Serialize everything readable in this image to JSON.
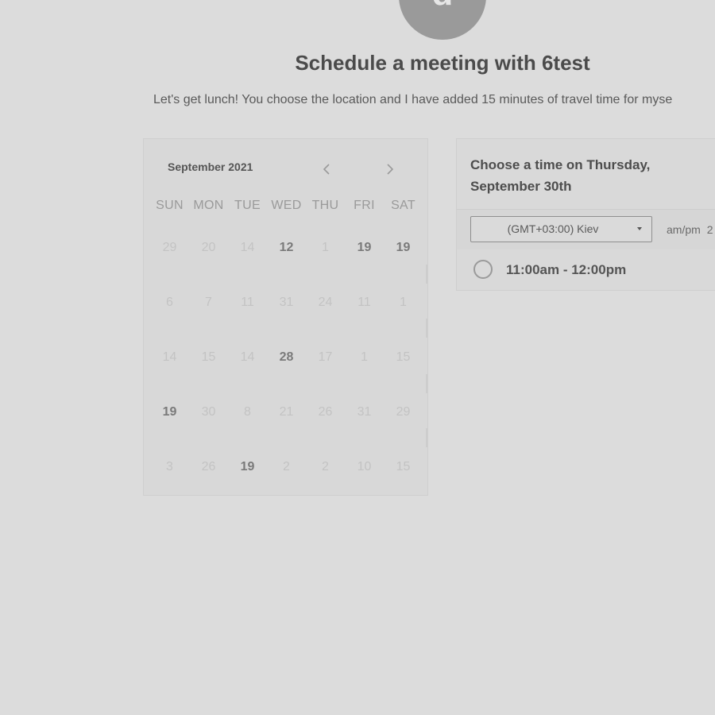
{
  "avatar": {
    "initial": "d"
  },
  "header": {
    "title": "Schedule a meeting with 6test",
    "subtitle": "Let's get lunch! You choose the location and I have added 15 minutes of travel time for myse"
  },
  "calendar": {
    "month_label": "September 2021",
    "weekdays": [
      "SUN",
      "MON",
      "TUE",
      "WED",
      "THU",
      "FRI",
      "SAT"
    ],
    "weeks": [
      [
        {
          "label": "29",
          "available": false
        },
        {
          "label": "20",
          "available": false
        },
        {
          "label": "14",
          "available": false
        },
        {
          "label": "12",
          "available": true
        },
        {
          "label": "1",
          "available": false
        },
        {
          "label": "19",
          "available": true
        },
        {
          "label": "19",
          "available": true
        }
      ],
      [
        {
          "label": "6",
          "available": false
        },
        {
          "label": "7",
          "available": false
        },
        {
          "label": "11",
          "available": false
        },
        {
          "label": "31",
          "available": false
        },
        {
          "label": "24",
          "available": false
        },
        {
          "label": "11",
          "available": false
        },
        {
          "label": "1",
          "available": false
        }
      ],
      [
        {
          "label": "14",
          "available": false
        },
        {
          "label": "15",
          "available": false
        },
        {
          "label": "14",
          "available": false
        },
        {
          "label": "28",
          "available": true
        },
        {
          "label": "17",
          "available": false
        },
        {
          "label": "1",
          "available": false
        },
        {
          "label": "15",
          "available": false
        }
      ],
      [
        {
          "label": "19",
          "available": true
        },
        {
          "label": "30",
          "available": false
        },
        {
          "label": "8",
          "available": false
        },
        {
          "label": "21",
          "available": false
        },
        {
          "label": "26",
          "available": false
        },
        {
          "label": "31",
          "available": false
        },
        {
          "label": "29",
          "available": false
        }
      ],
      [
        {
          "label": "3",
          "available": false
        },
        {
          "label": "26",
          "available": false
        },
        {
          "label": "19",
          "available": true
        },
        {
          "label": "2",
          "available": false
        },
        {
          "label": "2",
          "available": false
        },
        {
          "label": "10",
          "available": false
        },
        {
          "label": "15",
          "available": false
        }
      ]
    ]
  },
  "times": {
    "title": "Choose a time on Thursday, September 30th",
    "timezone": "(GMT+03:00) Kiev",
    "format_label": "am/pm",
    "format_alt": "2",
    "slots": [
      {
        "label": "11:00am - 12:00pm"
      }
    ]
  },
  "icons": {
    "prev": "chevron-left-icon",
    "next": "chevron-right-icon",
    "dropdown": "caret-down-icon",
    "radio": "radio-empty-icon"
  }
}
